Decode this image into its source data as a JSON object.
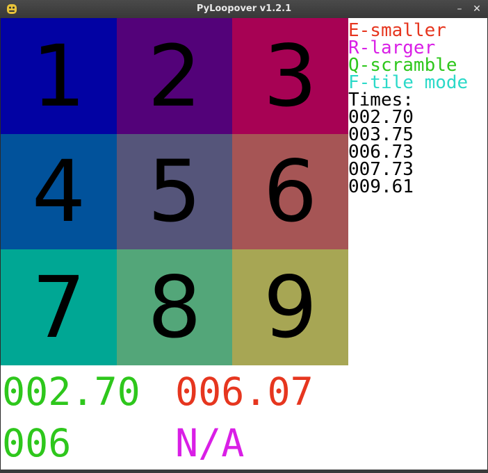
{
  "window": {
    "title": "PyLoopover v1.2.1",
    "minimize": "–",
    "close": "✕",
    "icon": "python-icon"
  },
  "board": {
    "tiles": [
      {
        "label": "1",
        "color": "#0202a3"
      },
      {
        "label": "2",
        "color": "#530279"
      },
      {
        "label": "3",
        "color": "#a70254"
      },
      {
        "label": "4",
        "color": "#01529b"
      },
      {
        "label": "5",
        "color": "#55557a"
      },
      {
        "label": "6",
        "color": "#a65555"
      },
      {
        "label": "7",
        "color": "#00a794"
      },
      {
        "label": "8",
        "color": "#53a679"
      },
      {
        "label": "9",
        "color": "#a7a654"
      }
    ]
  },
  "controls": [
    {
      "text": "E-smaller",
      "color": "#e6361f"
    },
    {
      "text": "R-larger",
      "color": "#d91fe6"
    },
    {
      "text": "Q-scramble",
      "color": "#2ec71c"
    },
    {
      "text": "F-tile mode",
      "color": "#2bd9c8"
    }
  ],
  "times": {
    "header": "Times:",
    "list": [
      "002.70",
      "003.75",
      "006.73",
      "007.73",
      "009.61"
    ]
  },
  "stats": {
    "best_time": "002.70",
    "current_time": "006.07",
    "moves": "006",
    "other": "N/A",
    "colors": {
      "green": "#2ec71c",
      "red": "#e6361f",
      "magenta": "#d91fe6"
    }
  }
}
